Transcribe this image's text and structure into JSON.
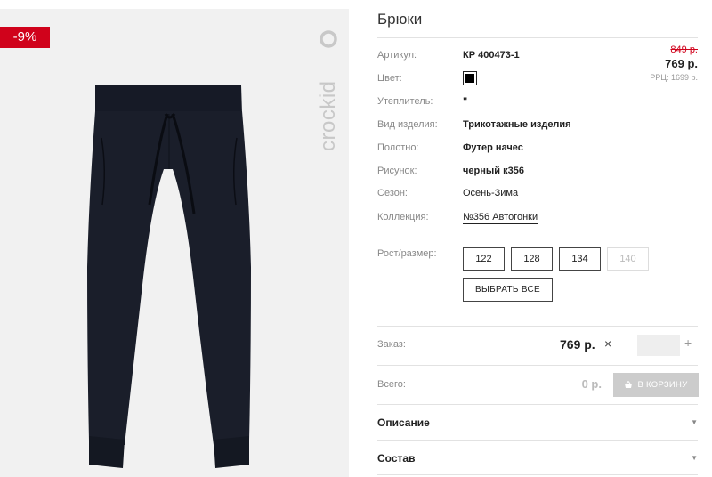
{
  "product": {
    "title": "Брюки",
    "discount_badge": "-9%",
    "brand_logo_text": "crockid"
  },
  "price": {
    "old": "849 р.",
    "current": "769 р.",
    "rrp": "РРЦ: 1699 р."
  },
  "attributes": {
    "article_label": "Артикул:",
    "article_value": "КР 400473-1",
    "color_label": "Цвет:",
    "color_value": "#000000",
    "insulation_label": "Утеплитель:",
    "insulation_value": "\"",
    "type_label": "Вид изделия:",
    "type_value": "Трикотажные изделия",
    "fabric_label": "Полотно:",
    "fabric_value": "Футер начес",
    "pattern_label": "Рисунок:",
    "pattern_value": "черный к356",
    "season_label": "Сезон:",
    "season_value": "Осень-Зима",
    "collection_label": "Коллекция:",
    "collection_value": "№356 Автогонки"
  },
  "sizes": {
    "label": "Рост/размер:",
    "options": [
      {
        "label": "122",
        "available": true
      },
      {
        "label": "128",
        "available": true
      },
      {
        "label": "134",
        "available": true
      },
      {
        "label": "140",
        "available": false
      }
    ],
    "select_all": "ВЫБРАТЬ ВСЕ"
  },
  "order": {
    "label": "Заказ:",
    "price": "769 р.",
    "times": "×",
    "minus": "–",
    "plus": "+",
    "quantity": ""
  },
  "total": {
    "label": "Всего:",
    "value": "0 р.",
    "cart_button": "В КОРЗИНУ"
  },
  "sections": {
    "description": "Описание",
    "composition": "Состав"
  },
  "colors": {
    "accent_red": "#d0021b",
    "product_fabric": "#1a1e2a",
    "cart_disabled": "#cccccc"
  }
}
